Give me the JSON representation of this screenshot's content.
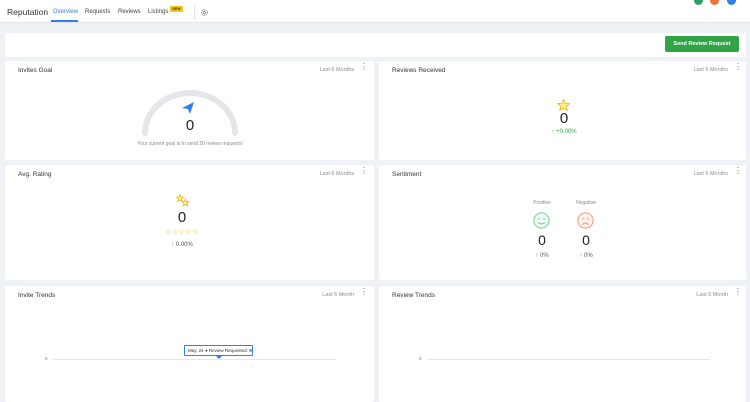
{
  "header": {
    "brand": "Reputation",
    "tabs": [
      {
        "label": "Overview"
      },
      {
        "label": "Requests"
      },
      {
        "label": "Reviews"
      },
      {
        "label": "Listings"
      }
    ],
    "new_badge": "NEW",
    "avatar_colors": [
      "#2e9d6a",
      "#e8743b",
      "#2f80ed"
    ]
  },
  "actions": {
    "send_review_request": "Send Review Request"
  },
  "cards": {
    "invites_goal": {
      "title": "Invites Goal",
      "range": "Last 6 Months",
      "value": "0",
      "caption": "Your current goal is to send 20 review requests!",
      "icon": "paper-plane-icon"
    },
    "reviews_received": {
      "title": "Reviews Received",
      "range": "Last 6 Months",
      "value": "0",
      "change": "+0.00%",
      "icon": "star-icon"
    },
    "avg_rating": {
      "title": "Avg. Rating",
      "range": "Last 6 Months",
      "value": "0",
      "stars": "☆☆☆☆☆",
      "change": "0.00%",
      "icon": "rating-icon"
    },
    "sentiment": {
      "title": "Sentiment",
      "range": "Last 6 Months",
      "positive_label": "Positive",
      "negative_label": "Negative",
      "positive_value": "0",
      "negative_value": "0",
      "positive_change": "0%",
      "negative_change": "0%",
      "positive_color": "#7fd3a1",
      "negative_color": "#f0a188"
    },
    "invite_trends": {
      "title": "Invite Trends",
      "range": "Last 6 Month",
      "y_tick": "0",
      "tooltip_date": "May, 24",
      "tooltip_label": "Review Requested:",
      "tooltip_value": "0"
    },
    "review_trends": {
      "title": "Review Trends",
      "range": "Last 6 Month",
      "y_tick": "0"
    }
  },
  "colors": {
    "accent": "#2f80ed",
    "primary_button": "#30a447",
    "star": "#f0b400"
  }
}
